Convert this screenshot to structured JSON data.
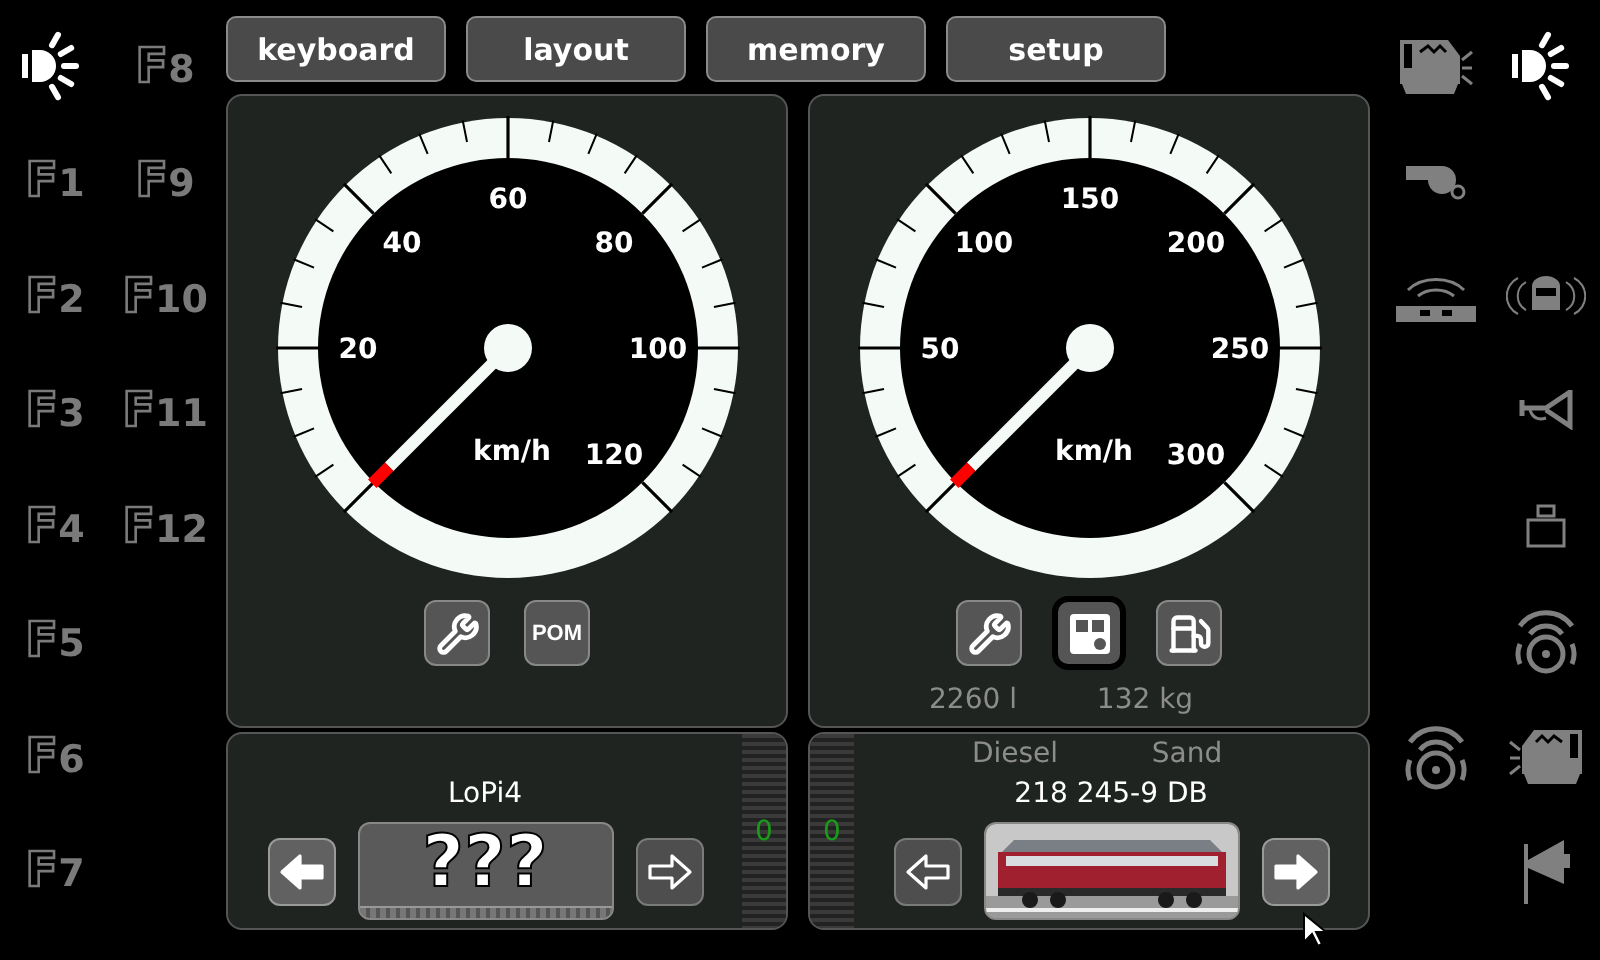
{
  "top_buttons": [
    {
      "label": "keyboard"
    },
    {
      "label": "layout"
    },
    {
      "label": "memory"
    },
    {
      "label": "setup"
    }
  ],
  "left_functions": [
    {
      "left": {
        "kind": "light",
        "on": true
      },
      "right": {
        "kind": "key",
        "label": "F8",
        "on": false
      }
    },
    {
      "left": {
        "kind": "key",
        "label": "F1",
        "on": false
      },
      "right": {
        "kind": "key",
        "label": "F9",
        "on": false
      }
    },
    {
      "left": {
        "kind": "key",
        "label": "F2",
        "on": false
      },
      "right": {
        "kind": "key",
        "label": "F10",
        "on": false
      }
    },
    {
      "left": {
        "kind": "key",
        "label": "F3",
        "on": false
      },
      "right": {
        "kind": "key",
        "label": "F11",
        "on": false
      }
    },
    {
      "left": {
        "kind": "key",
        "label": "F4",
        "on": false
      },
      "right": {
        "kind": "key",
        "label": "F12",
        "on": false
      }
    },
    {
      "left": {
        "kind": "key",
        "label": "F5",
        "on": false
      }
    },
    {
      "left": {
        "kind": "key",
        "label": "F6",
        "on": false
      }
    },
    {
      "left": {
        "kind": "key",
        "label": "F7",
        "on": false
      }
    }
  ],
  "throttles": [
    {
      "gauge": {
        "unit": "km/h",
        "scale": [
          "20",
          "40",
          "60",
          "80",
          "100",
          "120"
        ]
      },
      "tools": [
        {
          "kind": "wrench",
          "selected": false
        },
        {
          "kind": "text",
          "label": "POM",
          "selected": false
        }
      ],
      "loco": {
        "name": "LoPi4",
        "image": {
          "kind": "unknown",
          "text": "???"
        },
        "arrows": [
          {
            "selected": true
          },
          {
            "selected": false
          }
        ],
        "step": "0"
      }
    },
    {
      "gauge": {
        "unit": "km/h",
        "scale": [
          "50",
          "100",
          "150",
          "200",
          "250",
          "300"
        ]
      },
      "tools": [
        {
          "kind": "wrench",
          "selected": false
        },
        {
          "kind": "display",
          "selected": true
        },
        {
          "kind": "fuel",
          "selected": false
        }
      ],
      "readings": [
        "2260 l",
        "132 kg"
      ],
      "loco": {
        "reading_labels": [
          "Diesel",
          "Sand"
        ],
        "name": "218 245-9 DB",
        "image": {
          "kind": "picture"
        },
        "arrows": [
          {
            "selected": false
          },
          {
            "selected": true
          }
        ],
        "step": "0"
      }
    }
  ],
  "right_functions": [
    {
      "left": {
        "kind": "loco_light",
        "on": false
      },
      "right": {
        "kind": "light",
        "on": true
      }
    },
    {
      "left": {
        "kind": "whistle",
        "on": false
      }
    },
    {
      "left": {
        "kind": "radio_car",
        "on": false
      },
      "right": {
        "kind": "sound_front",
        "on": false
      }
    },
    {
      "right": {
        "kind": "horn",
        "on": false
      }
    },
    {
      "right": {
        "kind": "weight",
        "on": false
      }
    },
    {
      "right": {
        "kind": "sound",
        "on": false
      }
    },
    {
      "left": {
        "kind": "sound",
        "on": false
      },
      "right": {
        "kind": "loco_light_rev",
        "on": false
      }
    },
    {
      "right": {
        "kind": "flag_horn",
        "on": false
      }
    }
  ]
}
